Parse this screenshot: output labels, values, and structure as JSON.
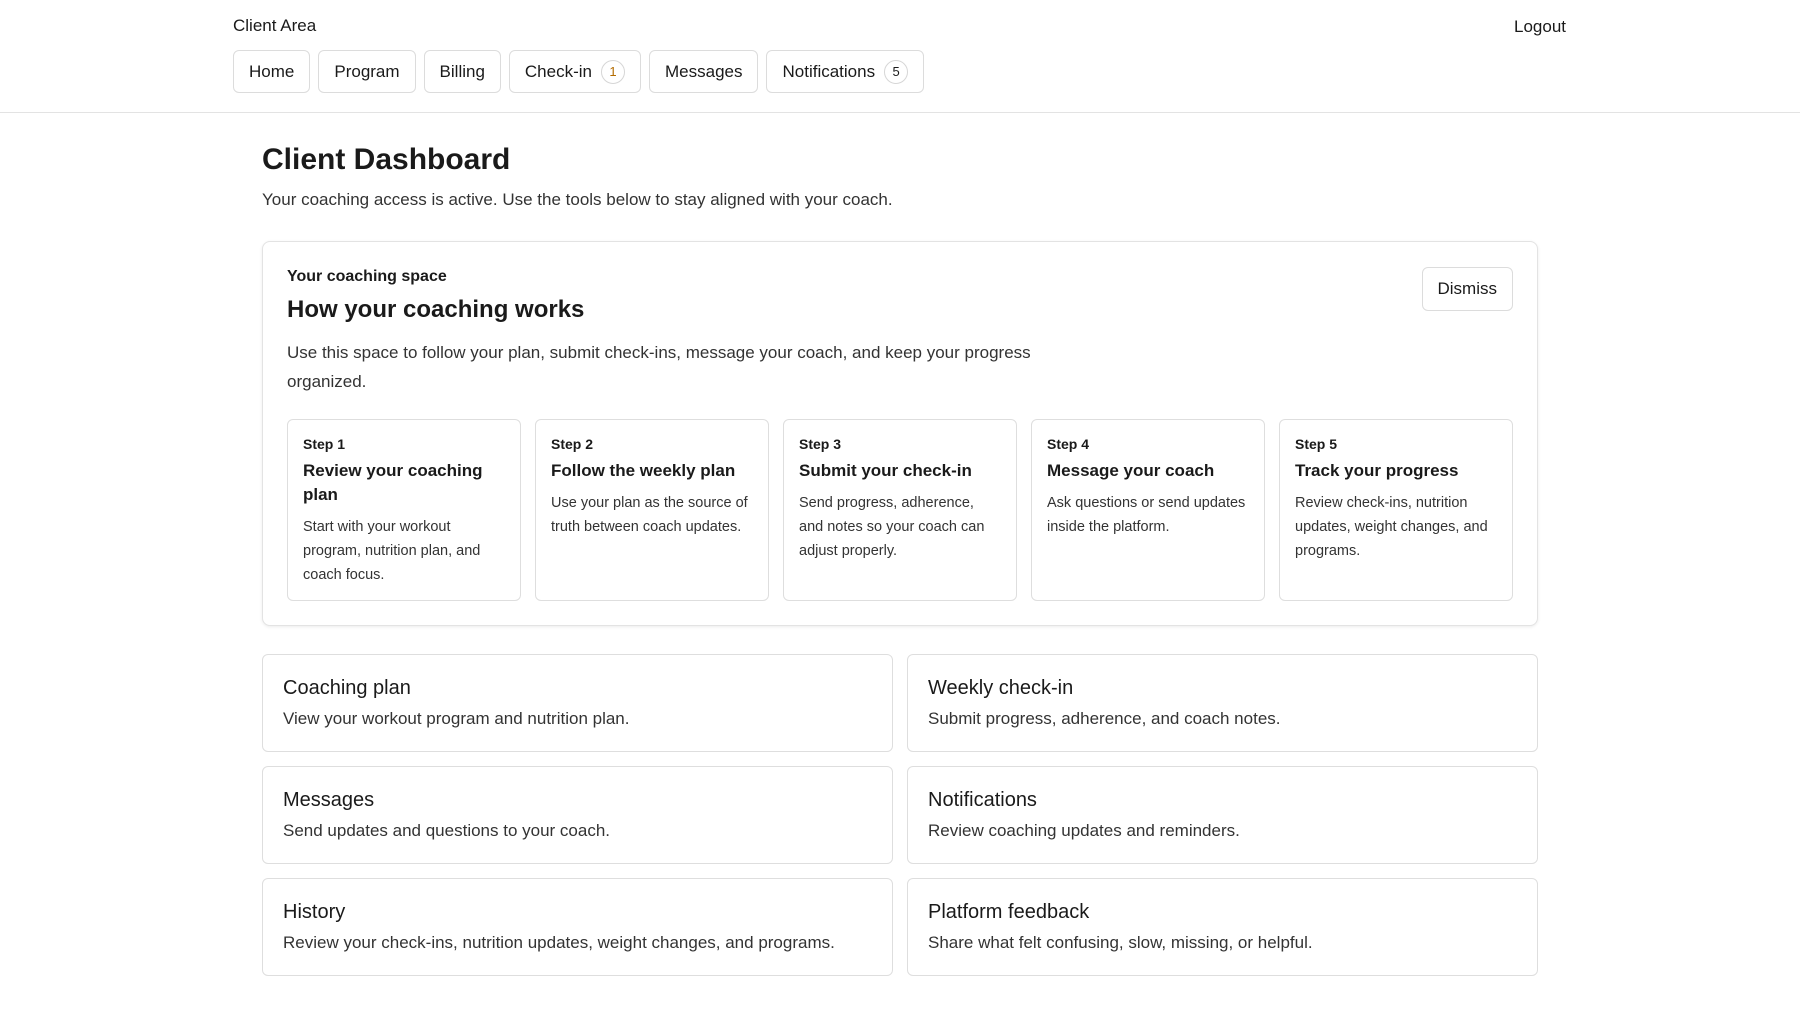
{
  "header": {
    "brand": "Client Area",
    "logout_label": "Logout",
    "nav": [
      {
        "label": "Home"
      },
      {
        "label": "Program"
      },
      {
        "label": "Billing"
      },
      {
        "label": "Check-in",
        "badge": "1"
      },
      {
        "label": "Messages"
      },
      {
        "label": "Notifications",
        "badge": "5"
      }
    ]
  },
  "page": {
    "title": "Client Dashboard",
    "subtitle": "Your coaching access is active. Use the tools below to stay aligned with your coach."
  },
  "onboarding": {
    "eyebrow": "Your coaching space",
    "title": "How your coaching works",
    "description": "Use this space to follow your plan, submit check-ins, message your coach, and keep your progress organized.",
    "dismiss_label": "Dismiss",
    "steps": [
      {
        "num": "Step 1",
        "title": "Review your coaching plan",
        "text": "Start with your workout program, nutrition plan, and coach focus."
      },
      {
        "num": "Step 2",
        "title": "Follow the weekly plan",
        "text": "Use your plan as the source of truth between coach updates."
      },
      {
        "num": "Step 3",
        "title": "Submit your check-in",
        "text": "Send progress, adherence, and notes so your coach can adjust properly."
      },
      {
        "num": "Step 4",
        "title": "Message your coach",
        "text": "Ask questions or send updates inside the platform."
      },
      {
        "num": "Step 5",
        "title": "Track your progress",
        "text": "Review check-ins, nutrition updates, weight changes, and programs."
      }
    ]
  },
  "cards": [
    {
      "title": "Coaching plan",
      "text": "View your workout program and nutrition plan."
    },
    {
      "title": "Weekly check-in",
      "text": "Submit progress, adherence, and coach notes."
    },
    {
      "title": "Messages",
      "text": "Send updates and questions to your coach."
    },
    {
      "title": "Notifications",
      "text": "Review coaching updates and reminders."
    },
    {
      "title": "History",
      "text": "Review your check-ins, nutrition updates, weight changes, and programs."
    },
    {
      "title": "Platform feedback",
      "text": "Share what felt confusing, slow, missing, or helpful."
    }
  ],
  "colors": {
    "badge_warning": "#b36b00",
    "border": "#dedede",
    "text": "#1a1a1a"
  }
}
